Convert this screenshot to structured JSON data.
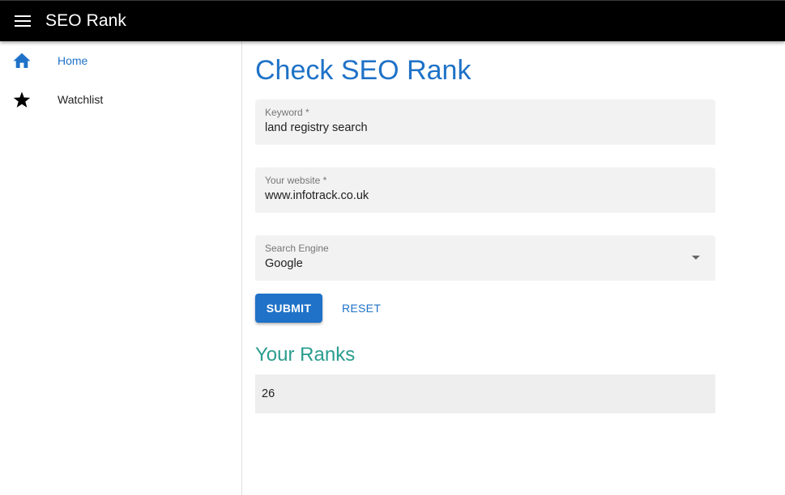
{
  "app": {
    "title": "SEO Rank",
    "menu_icon": "menu-icon"
  },
  "sidebar": {
    "items": [
      {
        "label": "Home",
        "icon": "home-icon",
        "active": true
      },
      {
        "label": "Watchlist",
        "icon": "star-icon",
        "active": false
      }
    ]
  },
  "main": {
    "title": "Check SEO Rank",
    "fields": {
      "keyword": {
        "label": "Keyword *",
        "value": "land registry search"
      },
      "website": {
        "label": "Your website *",
        "value": "www.infotrack.co.uk"
      },
      "engine": {
        "label": "Search Engine",
        "value": "Google"
      }
    },
    "buttons": {
      "submit": "SUBMIT",
      "reset": "RESET"
    },
    "ranks": {
      "title": "Your Ranks",
      "value": "26"
    }
  },
  "colors": {
    "primary": "#1f72c8",
    "secondary": "#2a9d8f",
    "appbar": "#000000"
  }
}
